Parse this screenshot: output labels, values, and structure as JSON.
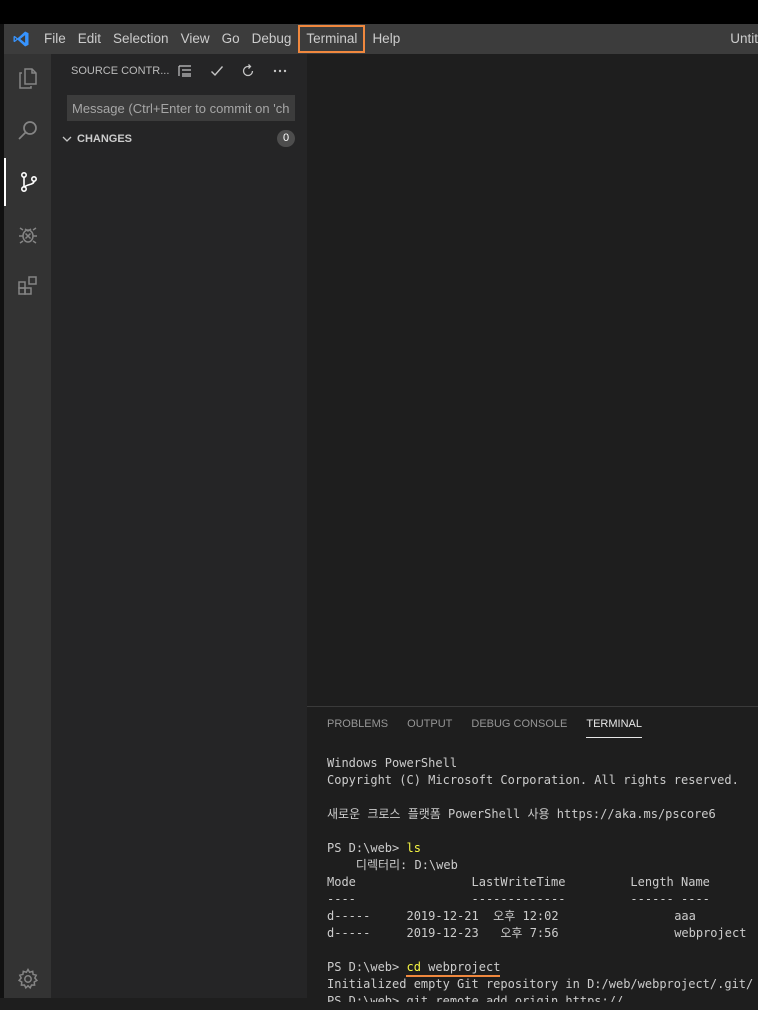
{
  "menubar": {
    "items": [
      "File",
      "Edit",
      "Selection",
      "View",
      "Go",
      "Debug",
      "Terminal",
      "Help"
    ],
    "highlighted": "Terminal",
    "window_title": "Untit"
  },
  "activity_bar": {
    "icons": [
      "files-icon",
      "search-icon",
      "source-control-icon",
      "debug-icon",
      "extensions-icon"
    ],
    "active": "source-control-icon",
    "bottom_icon": "settings-gear-icon"
  },
  "sidebar": {
    "title": "SOURCE CONTR...",
    "tools": [
      "tree-view-icon",
      "check-icon",
      "refresh-icon",
      "more-icon"
    ],
    "commit_placeholder": "Message (Ctrl+Enter to commit on 'cha",
    "changes_label": "CHANGES",
    "changes_count": "0"
  },
  "panel": {
    "tabs": [
      "PROBLEMS",
      "OUTPUT",
      "DEBUG CONSOLE",
      "TERMINAL"
    ],
    "active_tab": "TERMINAL"
  },
  "terminal": {
    "l1": "Windows PowerShell",
    "l2": "Copyright (C) Microsoft Corporation. All rights reserved.",
    "l3": "새로운 크로스 플랫폼 PowerShell 사용 https://aka.ms/pscore6",
    "prompt1": "PS D:\\web> ",
    "cmd1": "ls",
    "dir_line": "    디렉터리: D:\\web",
    "hdr": "Mode                LastWriteTime         Length Name",
    "sep": "----                -------------         ------ ----",
    "row1": "d-----     2019-12-21  오후 12:02                aaa",
    "row2": "d-----     2019-12-23   오후 7:56                webproject",
    "prompt2": "PS D:\\web> ",
    "cmd2a": "cd",
    "cmd2b": "webproject",
    "out2": "Initialized empty Git repository in D:/web/webproject/.git/",
    "partial": "PS D:\\web> git remote add origin https://..."
  },
  "colors": {
    "highlight": "#f0883e",
    "command": "#f5f543",
    "vscode_blue": "#3794ff"
  }
}
